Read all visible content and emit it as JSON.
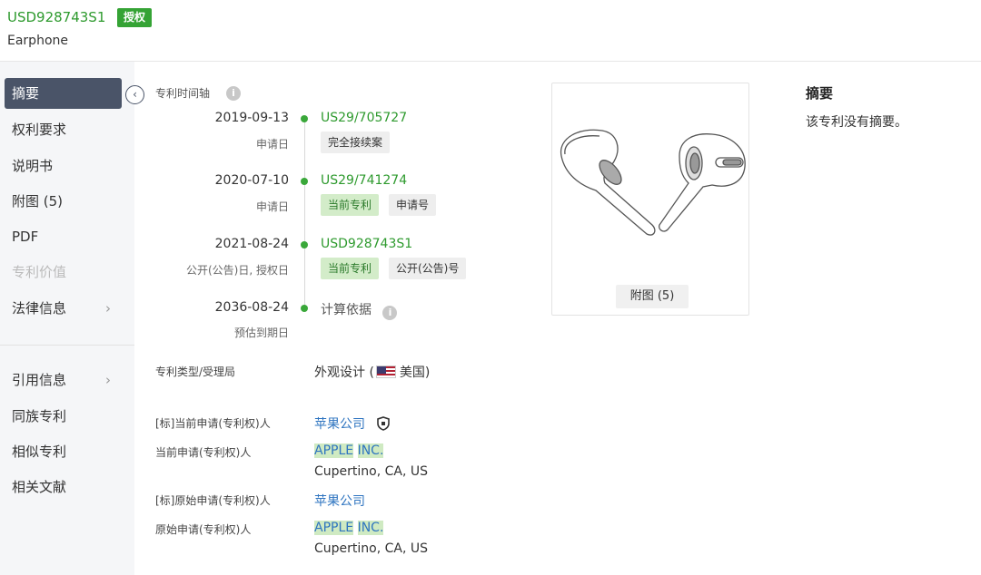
{
  "header": {
    "patent_number": "USD928743S1",
    "status_badge": "授权",
    "subtitle": "Earphone"
  },
  "sidebar": {
    "items": [
      {
        "label": "摘要",
        "state": "active"
      },
      {
        "label": "权利要求"
      },
      {
        "label": "说明书"
      },
      {
        "label": "附图 (5)"
      },
      {
        "label": "PDF"
      },
      {
        "label": "专利价值",
        "state": "disabled"
      },
      {
        "label": "法律信息",
        "chevron": "›"
      },
      {
        "label": "引用信息",
        "chevron": "›"
      },
      {
        "label": "同族专利"
      },
      {
        "label": "相似专利"
      },
      {
        "label": "相关文献"
      }
    ],
    "collapse_icon": "‹"
  },
  "timeline": {
    "title": "专利时间轴",
    "info_icon": "i",
    "events": [
      {
        "date": "2019-09-13",
        "label": "申请日",
        "number": "US29/705727",
        "tags": [
          "完全接续案"
        ]
      },
      {
        "date": "2020-07-10",
        "label": "申请日",
        "number": "US29/741274",
        "tags": [
          "当前专利",
          "申请号"
        ]
      },
      {
        "date": "2021-08-24",
        "label": "公开(公告)日, 授权日",
        "number": "USD928743S1",
        "tags": [
          "当前专利",
          "公开(公告)号"
        ]
      },
      {
        "date": "2036-08-24",
        "label": "预估到期日",
        "number": "计算依据"
      }
    ]
  },
  "fields": {
    "type_label": "专利类型/受理局",
    "type_value_prefix": "外观设计 (",
    "type_value_country": "美国)",
    "std_current_label": "[标]当前申请(专利权)人",
    "std_current_value": "苹果公司",
    "current_label": "当前申请(专利权)人",
    "current_name_1": "APPLE",
    "current_name_2": "INC.",
    "current_address": "Cupertino, CA, US",
    "std_original_label": "[标]原始申请(专利权)人",
    "std_original_value": "苹果公司",
    "original_label": "原始申请(专利权)人",
    "original_name_1": "APPLE",
    "original_name_2": "INC.",
    "original_address": "Cupertino, CA, US"
  },
  "figure": {
    "button_label": "附图 (5)"
  },
  "abstract": {
    "title": "摘要",
    "text": "该专利没有摘要。"
  },
  "colors": {
    "accent_green": "#3aa83a",
    "nav_active": "#4a5468",
    "link_blue": "#2e74c0"
  }
}
